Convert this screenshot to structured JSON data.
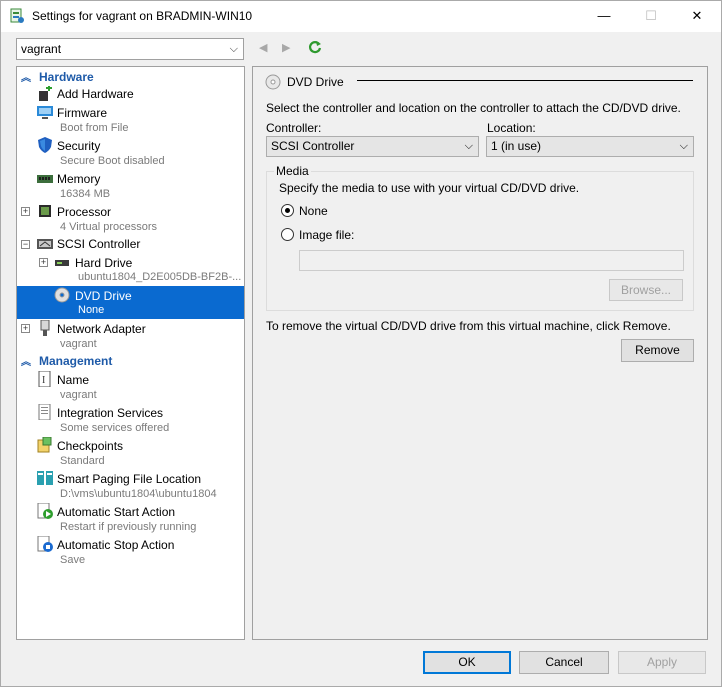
{
  "window": {
    "title": "Settings for vagrant on BRADMIN-WIN10",
    "min_glyph": "—",
    "max_glyph": "☐",
    "close_glyph": "✕"
  },
  "toolbar": {
    "vm_selected": "vagrant",
    "back_glyph": "◀",
    "forward_glyph": "▶"
  },
  "tree": {
    "hardware_header": "Hardware",
    "management_header": "Management",
    "items": [
      {
        "label": "Add Hardware",
        "sub": ""
      },
      {
        "label": "Firmware",
        "sub": "Boot from File"
      },
      {
        "label": "Security",
        "sub": "Secure Boot disabled"
      },
      {
        "label": "Memory",
        "sub": "16384 MB"
      },
      {
        "label": "Processor",
        "sub": "4 Virtual processors"
      },
      {
        "label": "SCSI Controller",
        "sub": ""
      },
      {
        "label": "Hard Drive",
        "sub": "ubuntu1804_D2E005DB-BF2B-..."
      },
      {
        "label": "DVD Drive",
        "sub": "None"
      },
      {
        "label": "Network Adapter",
        "sub": "vagrant"
      },
      {
        "label": "Name",
        "sub": "vagrant"
      },
      {
        "label": "Integration Services",
        "sub": "Some services offered"
      },
      {
        "label": "Checkpoints",
        "sub": "Standard"
      },
      {
        "label": "Smart Paging File Location",
        "sub": "D:\\vms\\ubuntu1804\\ubuntu1804"
      },
      {
        "label": "Automatic Start Action",
        "sub": "Restart if previously running"
      },
      {
        "label": "Automatic Stop Action",
        "sub": "Save"
      }
    ]
  },
  "detail": {
    "title": "DVD Drive",
    "instructions": "Select the controller and location on the controller to attach the CD/DVD drive.",
    "controller_label": "Controller:",
    "controller_value": "SCSI Controller",
    "location_label": "Location:",
    "location_value": "1 (in use)",
    "media_label": "Media",
    "media_instructions": "Specify the media to use with your virtual CD/DVD drive.",
    "radio_none": "None",
    "radio_image": "Image file:",
    "image_path": "",
    "browse_label": "Browse...",
    "remove_text": "To remove the virtual CD/DVD drive from this virtual machine, click Remove.",
    "remove_label": "Remove"
  },
  "footer": {
    "ok": "OK",
    "cancel": "Cancel",
    "apply": "Apply"
  },
  "colors": {
    "selection": "#0a6ad0",
    "section_header": "#1e5aa8",
    "default_button_border": "#0078d7"
  }
}
